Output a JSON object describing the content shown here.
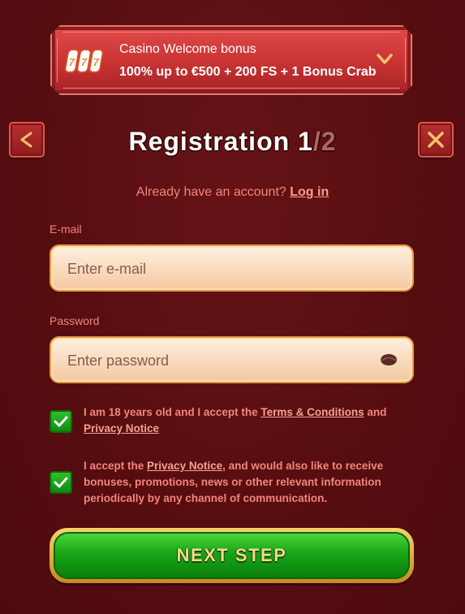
{
  "bonus": {
    "title": "Casino Welcome bonus",
    "subtitle": "100% up to €500 + 200 FS + 1 Bonus Crab"
  },
  "header": {
    "title_main": "Registration 1",
    "title_total": "/2"
  },
  "login_prompt": {
    "text": "Already have an account?",
    "link": "Log in"
  },
  "email": {
    "label": "E-mail",
    "placeholder": "Enter e-mail",
    "value": ""
  },
  "password": {
    "label": "Password",
    "placeholder": "Enter password",
    "value": ""
  },
  "consents": [
    {
      "checked": true,
      "text_before": "I am 18 years old and I accept the ",
      "link1": "Terms & Conditions",
      "text_middle": " and ",
      "link2": "Privacy Notice",
      "text_after": ""
    },
    {
      "checked": true,
      "text_before": "I accept the ",
      "link1": "Privacy Notice",
      "text_after": ", and would also like to receive bonuses, promotions, news or other relevant information periodically by any channel of communication."
    }
  ],
  "next_button": {
    "label": "NEXT STEP"
  },
  "colors": {
    "background": "#5a0f12",
    "accent_red": "#c83232",
    "text_pink": "#f2857a",
    "button_green": "#18a516",
    "gold": "#e69a3a"
  },
  "icons": {
    "back": "chevron-left-icon",
    "close": "close-icon",
    "expand": "chevron-down-icon",
    "slot": "slot-machine-icon",
    "password_toggle": "eye-icon",
    "check": "checkmark-icon"
  }
}
